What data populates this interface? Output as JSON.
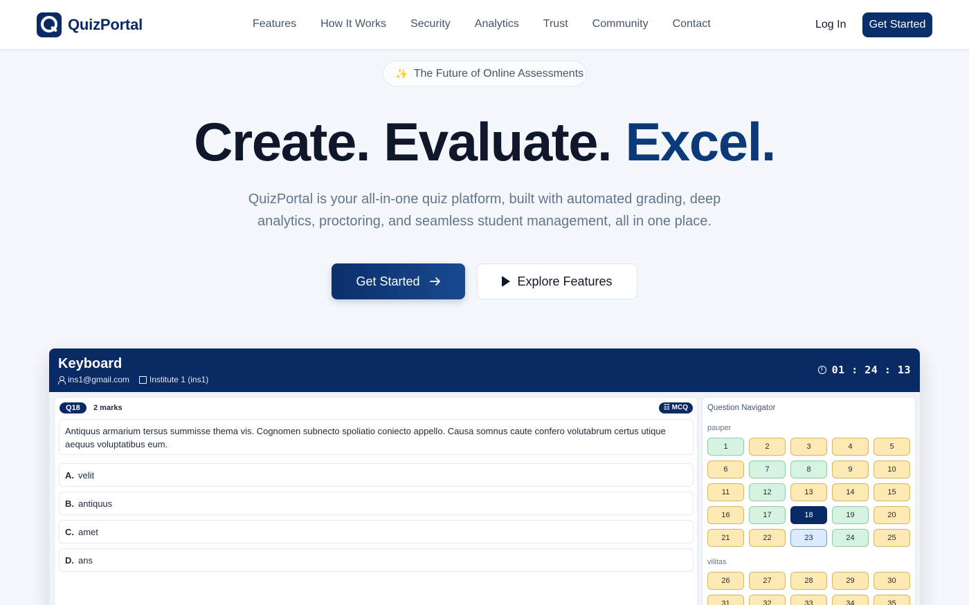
{
  "brand": {
    "name": "QuizPortal"
  },
  "nav": {
    "links": [
      "Features",
      "How It Works",
      "Security",
      "Analytics",
      "Trust",
      "Community",
      "Contact"
    ],
    "login": "Log In",
    "cta": "Get Started"
  },
  "hero": {
    "pill": "The Future of Online Assessments",
    "headline_part1": "Create. Evaluate.",
    "headline_accent": "Excel.",
    "subtitle": "QuizPortal is your all-in-one quiz platform, built with automated grading, deep analytics, proctoring, and seamless student management, all in one place.",
    "primary_button": "Get Started",
    "secondary_button": "Explore Features"
  },
  "preview": {
    "quiz_title": "Keyboard",
    "email": "ins1@gmail.com",
    "institute": "Institute 1 (ins1)",
    "timer": "01 : 24 : 13",
    "question": {
      "badge": "Q18",
      "marks": "2 marks",
      "type": "MCQ",
      "text": "Antiquus armarium tersus summisse thema vis. Cognomen subnecto spoliatio coniecto appello. Causa somnus caute confero volutabrum certus utique aequus voluptatibus eum.",
      "options": [
        {
          "letter": "A.",
          "text": "velit"
        },
        {
          "letter": "B.",
          "text": "antiquus"
        },
        {
          "letter": "C.",
          "text": "amet"
        },
        {
          "letter": "D.",
          "text": "ans"
        }
      ]
    },
    "navigator": {
      "title": "Question Navigator",
      "sections": [
        {
          "name": "pauper",
          "questions": [
            {
              "n": "1",
              "state": "answered"
            },
            {
              "n": "2",
              "state": "unanswered"
            },
            {
              "n": "3",
              "state": "unanswered"
            },
            {
              "n": "4",
              "state": "unanswered"
            },
            {
              "n": "5",
              "state": "unanswered"
            },
            {
              "n": "6",
              "state": "unanswered"
            },
            {
              "n": "7",
              "state": "answered"
            },
            {
              "n": "8",
              "state": "answered"
            },
            {
              "n": "9",
              "state": "unanswered"
            },
            {
              "n": "10",
              "state": "unanswered"
            },
            {
              "n": "11",
              "state": "unanswered"
            },
            {
              "n": "12",
              "state": "answered"
            },
            {
              "n": "13",
              "state": "unanswered"
            },
            {
              "n": "14",
              "state": "unanswered"
            },
            {
              "n": "15",
              "state": "unanswered"
            },
            {
              "n": "16",
              "state": "unanswered"
            },
            {
              "n": "17",
              "state": "answered"
            },
            {
              "n": "18",
              "state": "current"
            },
            {
              "n": "19",
              "state": "answered"
            },
            {
              "n": "20",
              "state": "unanswered"
            },
            {
              "n": "21",
              "state": "unanswered"
            },
            {
              "n": "22",
              "state": "unanswered"
            },
            {
              "n": "23",
              "state": "visited"
            },
            {
              "n": "24",
              "state": "answered"
            },
            {
              "n": "25",
              "state": "unanswered"
            }
          ]
        },
        {
          "name": "vilitas",
          "questions": [
            {
              "n": "26",
              "state": "unanswered"
            },
            {
              "n": "27",
              "state": "unanswered"
            },
            {
              "n": "28",
              "state": "unanswered"
            },
            {
              "n": "29",
              "state": "unanswered"
            },
            {
              "n": "30",
              "state": "unanswered"
            },
            {
              "n": "31",
              "state": "unanswered"
            },
            {
              "n": "32",
              "state": "unanswered"
            },
            {
              "n": "33",
              "state": "unanswered"
            },
            {
              "n": "34",
              "state": "unanswered"
            },
            {
              "n": "35",
              "state": "unanswered"
            }
          ]
        }
      ]
    }
  },
  "colors": {
    "primary": "#0b2f6b",
    "accent": "#0b3a7a",
    "answered": "#d6f3e2",
    "unanswered": "#fde9b4"
  }
}
